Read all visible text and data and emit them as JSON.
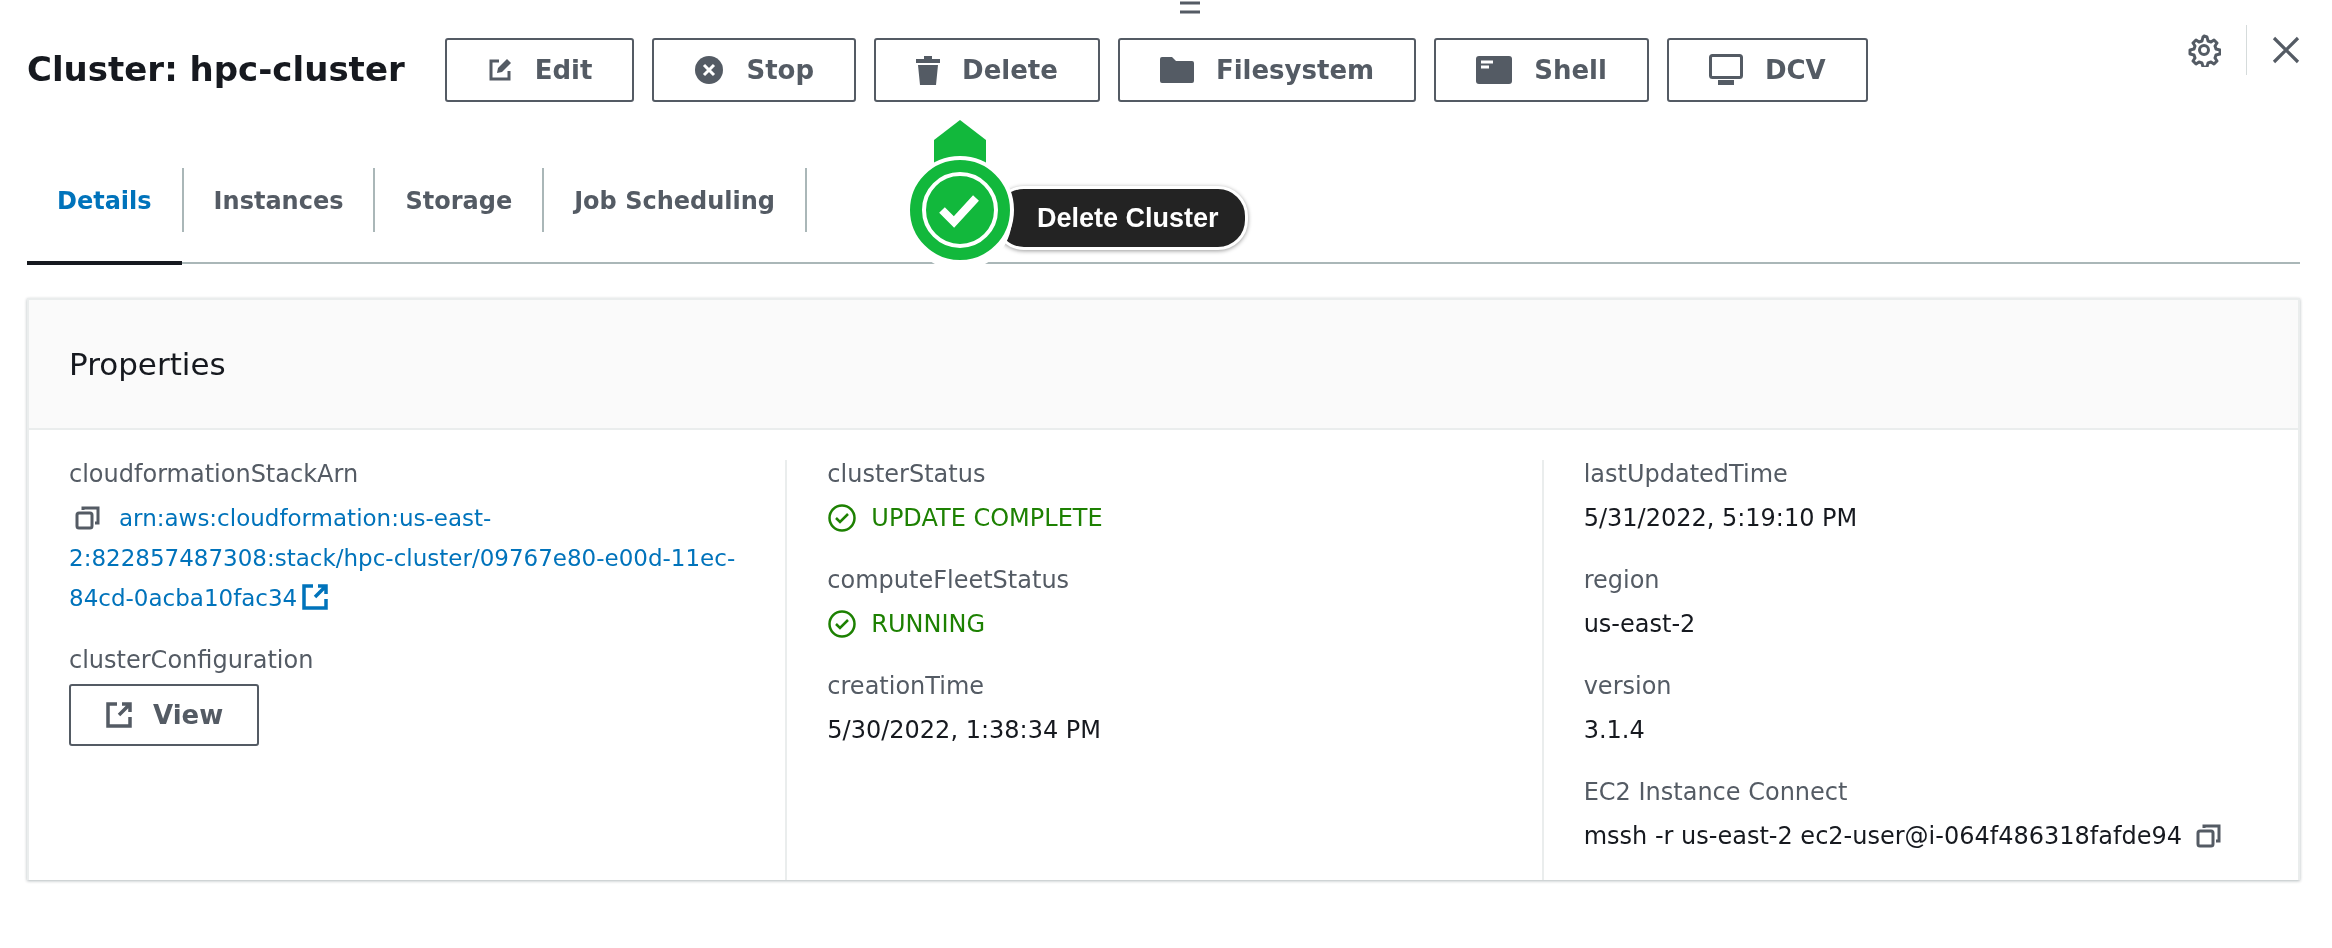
{
  "title": "Cluster: hpc-cluster",
  "actions": [
    {
      "label": "Edit"
    },
    {
      "label": "Stop"
    },
    {
      "label": "Delete"
    },
    {
      "label": "Filesystem"
    },
    {
      "label": "Shell"
    },
    {
      "label": "DCV"
    }
  ],
  "tabs": [
    {
      "label": "Details",
      "selected": true
    },
    {
      "label": "Instances",
      "selected": false
    },
    {
      "label": "Storage",
      "selected": false
    },
    {
      "label": "Job Scheduling",
      "selected": false
    }
  ],
  "callout": {
    "text": "Delete Cluster"
  },
  "panel": {
    "title": "Properties",
    "columns": [
      [
        {
          "label": "cloudformationStackArn",
          "kind": "link",
          "value": "arn:aws:cloudformation:us-east-2:822857487308:stack/hpc-cluster/09767e80-e00d-11ec-84cd-0acba10fac34"
        },
        {
          "label": "clusterConfiguration",
          "kind": "button",
          "value": "View"
        }
      ],
      [
        {
          "label": "clusterStatus",
          "kind": "status",
          "value": "UPDATE COMPLETE"
        },
        {
          "label": "computeFleetStatus",
          "kind": "status",
          "value": "RUNNING"
        },
        {
          "label": "creationTime",
          "kind": "text",
          "value": "5/30/2022, 1:38:34 PM"
        }
      ],
      [
        {
          "label": "lastUpdatedTime",
          "kind": "text",
          "value": "5/31/2022, 5:19:10 PM"
        },
        {
          "label": "region",
          "kind": "text",
          "value": "us-east-2"
        },
        {
          "label": "version",
          "kind": "text",
          "value": "3.1.4"
        },
        {
          "label": "EC2 Instance Connect",
          "kind": "copy",
          "value": "mssh -r us-east-2 ec2-user@i-064f486318fafde94"
        }
      ]
    ]
  }
}
